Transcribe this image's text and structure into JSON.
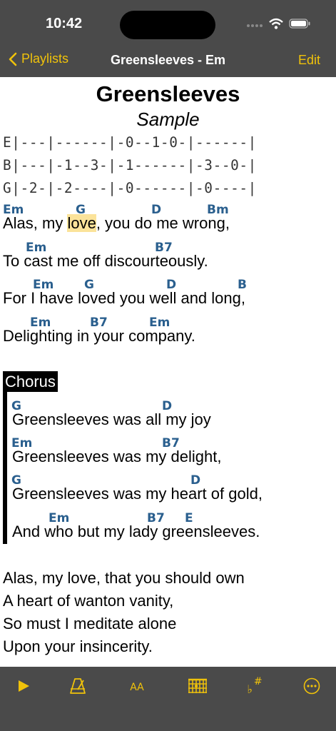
{
  "status_bar": {
    "time": "10:42"
  },
  "nav": {
    "back_label": "Playlists",
    "title": "Greensleeves - Em",
    "edit_label": "Edit"
  },
  "song": {
    "title": "Greensleeves",
    "subtitle": "Sample",
    "tab": [
      "E|---|------|-0--1-0-|------|",
      "B|---|-1--3-|-1------|-3--0-|",
      "G|-2-|-2----|-0------|-0----|"
    ],
    "verse1": {
      "lines": [
        {
          "chords": [
            "Em",
            "G",
            "D",
            "Bm"
          ],
          "pre": "Alas, my ",
          "highlight": "love",
          "post": ", you do me wrong,"
        },
        {
          "chords": [
            "Em",
            "B7"
          ],
          "text": "To cast me off discourteously."
        },
        {
          "chords": [
            "Em",
            "G",
            "D",
            "B"
          ],
          "text": "For I have loved you well and long,"
        },
        {
          "chords": [
            "Em",
            "B7",
            "Em"
          ],
          "text": "Delighting in your company."
        }
      ]
    },
    "chorus": {
      "label": "Chorus",
      "lines": [
        {
          "chords": [
            "G",
            "D"
          ],
          "text": "Greensleeves was all my joy"
        },
        {
          "chords": [
            "Em",
            "B7"
          ],
          "text": "Greensleeves was my delight,"
        },
        {
          "chords": [
            "G",
            "D"
          ],
          "text": "Greensleeves was my heart of gold,"
        },
        {
          "chords": [
            "Em",
            "B7",
            "E"
          ],
          "text": "And who but my lady greensleeves."
        }
      ]
    },
    "verse2": [
      "Alas, my love, that you should own",
      "A heart of wanton vanity,",
      "So must I meditate alone",
      "Upon your insincerity."
    ]
  },
  "toolbar": {
    "icons": [
      "play-icon",
      "metronome-icon",
      "font-size-icon",
      "chord-grid-icon",
      "transpose-icon",
      "more-icon"
    ],
    "font_size_label": "AA",
    "transpose_flat": "♭",
    "transpose_sharp": "#"
  },
  "colors": {
    "accent": "#f0c20a",
    "bar_background": "#4a4a4a",
    "chord": "#2a5f8e",
    "highlight": "#fbe39a"
  }
}
